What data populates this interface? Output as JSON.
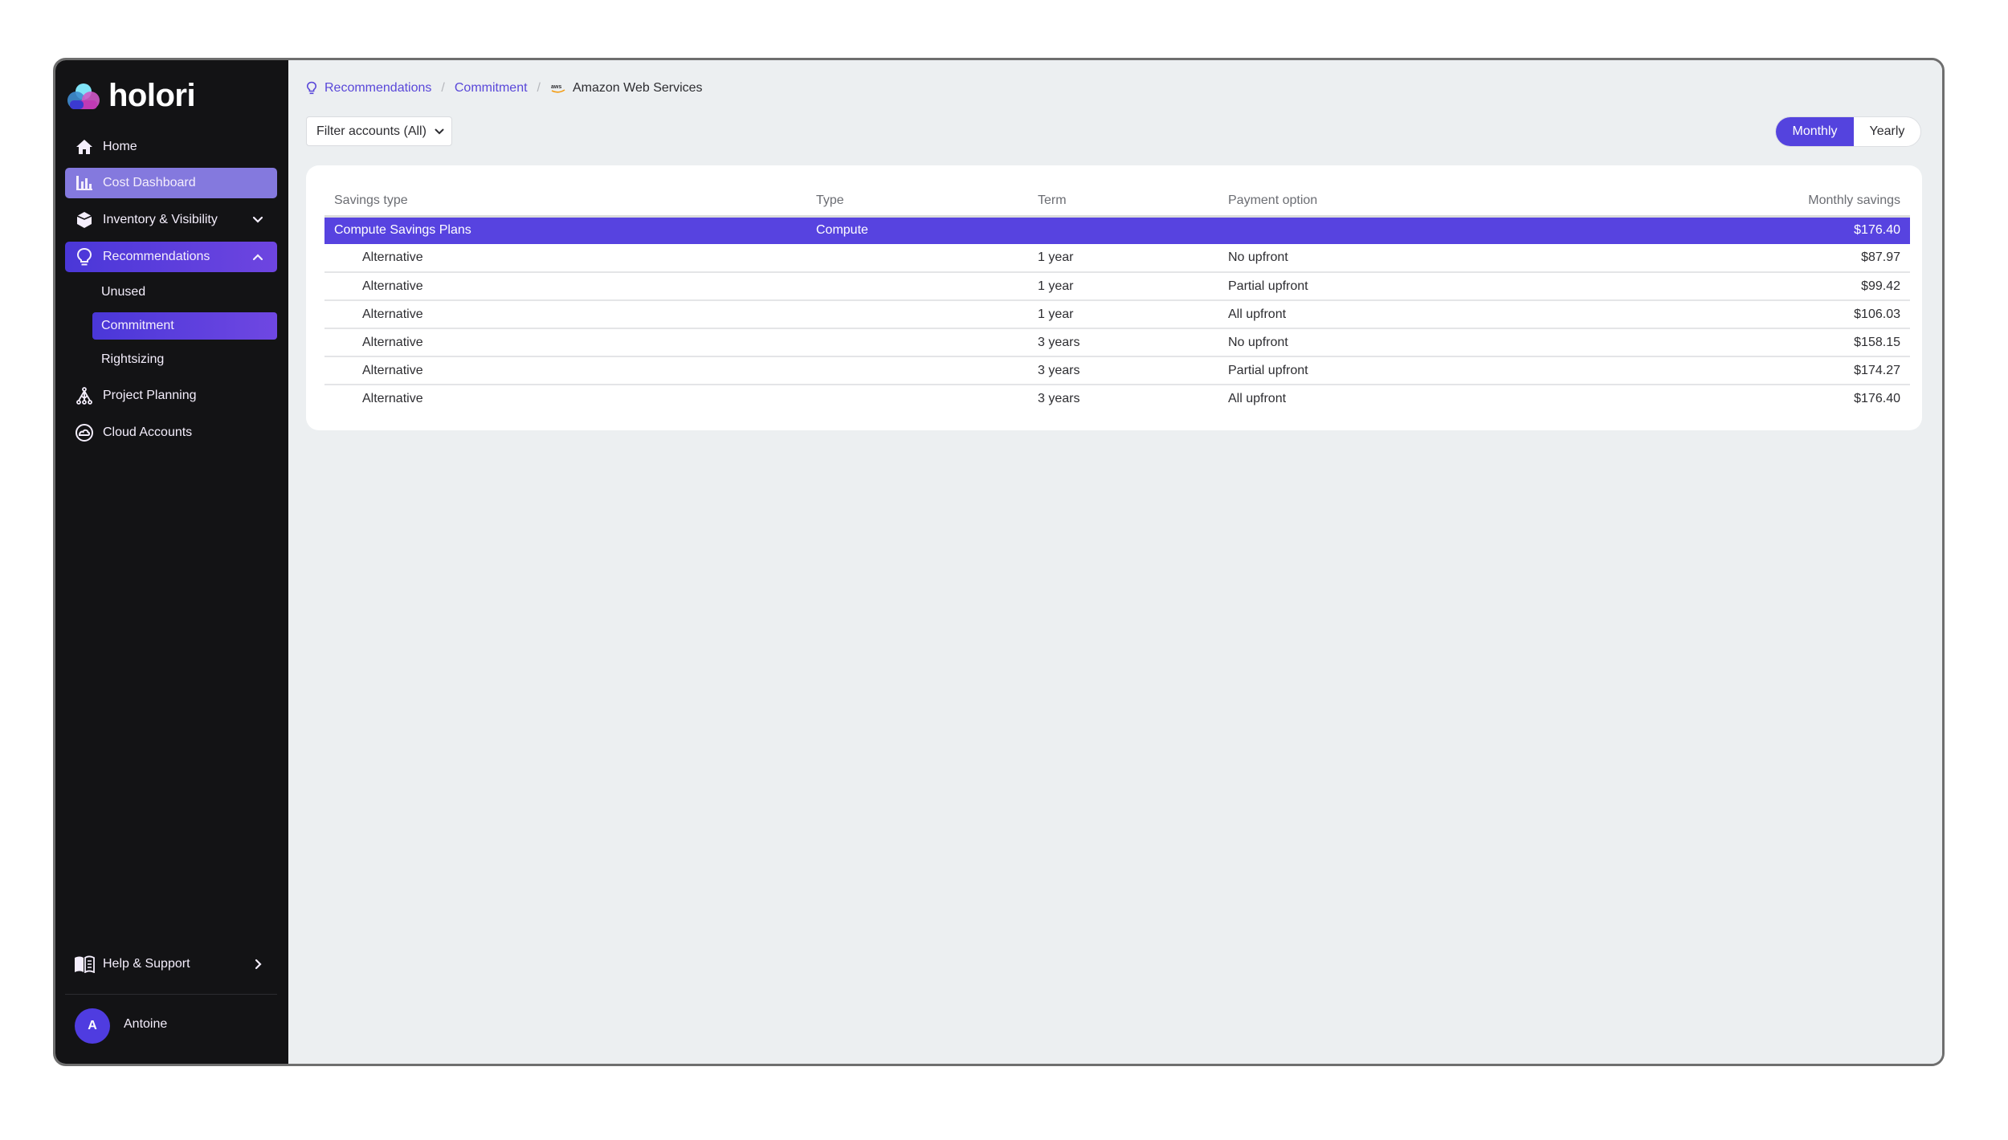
{
  "app": {
    "brand": "holori"
  },
  "sidebar": {
    "items": [
      {
        "label": "Home",
        "icon": "home-icon"
      },
      {
        "label": "Cost Dashboard",
        "icon": "bar-chart-icon"
      },
      {
        "label": "Inventory & Visibility",
        "icon": "cube-icon"
      },
      {
        "label": "Recommendations",
        "icon": "lightbulb-icon"
      },
      {
        "label": "Project Planning",
        "icon": "network-icon"
      },
      {
        "label": "Cloud Accounts",
        "icon": "cloud-circle-icon"
      }
    ],
    "sub_items": [
      {
        "label": "Unused"
      },
      {
        "label": "Commitment"
      },
      {
        "label": "Rightsizing"
      }
    ],
    "help": {
      "label": "Help & Support",
      "icon": "book-icon"
    },
    "user": {
      "initial": "A",
      "name": "Antoine"
    }
  },
  "breadcrumb": {
    "items": [
      {
        "label": "Recommendations"
      },
      {
        "label": "Commitment"
      },
      {
        "label": "Amazon Web Services"
      }
    ],
    "separator": "/"
  },
  "filter": {
    "label": "Filter accounts (All)"
  },
  "period_toggle": {
    "options": [
      "Monthly",
      "Yearly"
    ],
    "selected": "Monthly"
  },
  "table": {
    "columns": [
      "Savings type",
      "Type",
      "Term",
      "Payment option",
      "Monthly savings"
    ],
    "parent": {
      "savings_type": "Compute Savings Plans",
      "type": "Compute",
      "term": "",
      "payment": "",
      "savings": "$176.40"
    },
    "rows": [
      {
        "savings_type": "Alternative",
        "type": "",
        "term": "1 year",
        "payment": "No upfront",
        "savings": "$87.97"
      },
      {
        "savings_type": "Alternative",
        "type": "",
        "term": "1 year",
        "payment": "Partial upfront",
        "savings": "$99.42"
      },
      {
        "savings_type": "Alternative",
        "type": "",
        "term": "1 year",
        "payment": "All upfront",
        "savings": "$106.03"
      },
      {
        "savings_type": "Alternative",
        "type": "",
        "term": "3 years",
        "payment": "No upfront",
        "savings": "$158.15"
      },
      {
        "savings_type": "Alternative",
        "type": "",
        "term": "3 years",
        "payment": "Partial upfront",
        "savings": "$174.27"
      },
      {
        "savings_type": "Alternative",
        "type": "",
        "term": "3 years",
        "payment": "All upfront",
        "savings": "$176.40"
      }
    ]
  },
  "colors": {
    "accent": "#5743e0",
    "sidebar_bg": "#131315",
    "main_bg": "#eceff1",
    "link": "#5947d9"
  }
}
